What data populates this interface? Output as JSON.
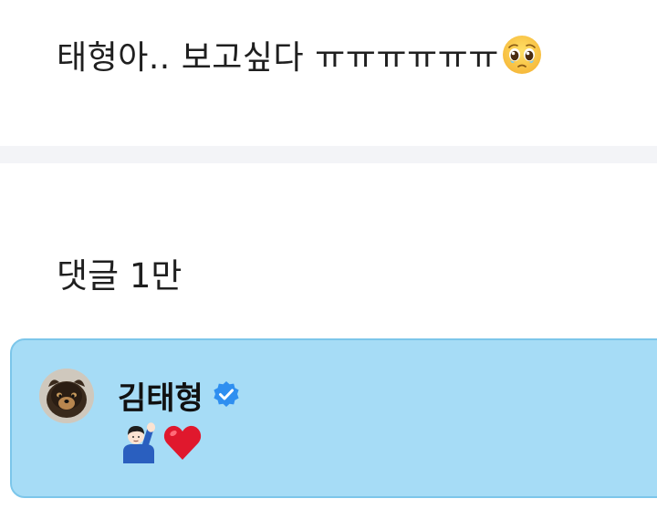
{
  "post": {
    "text": "태형아.. 보고싶다 ㅠㅠㅠㅠㅠㅠ",
    "trailing_emoji": "pleading-face-emoji"
  },
  "comments": {
    "header": "댓글 1만"
  },
  "pinned_comment": {
    "author": "김태형",
    "verified": true,
    "body_emojis": [
      "man-raising-hand-emoji",
      "red-heart-emoji"
    ]
  },
  "colors": {
    "pinned_background": "#a6dcf6",
    "pinned_border": "#7cc6ea",
    "verified_badge": "#2f8ff0",
    "divider": "#f3f4f7"
  }
}
